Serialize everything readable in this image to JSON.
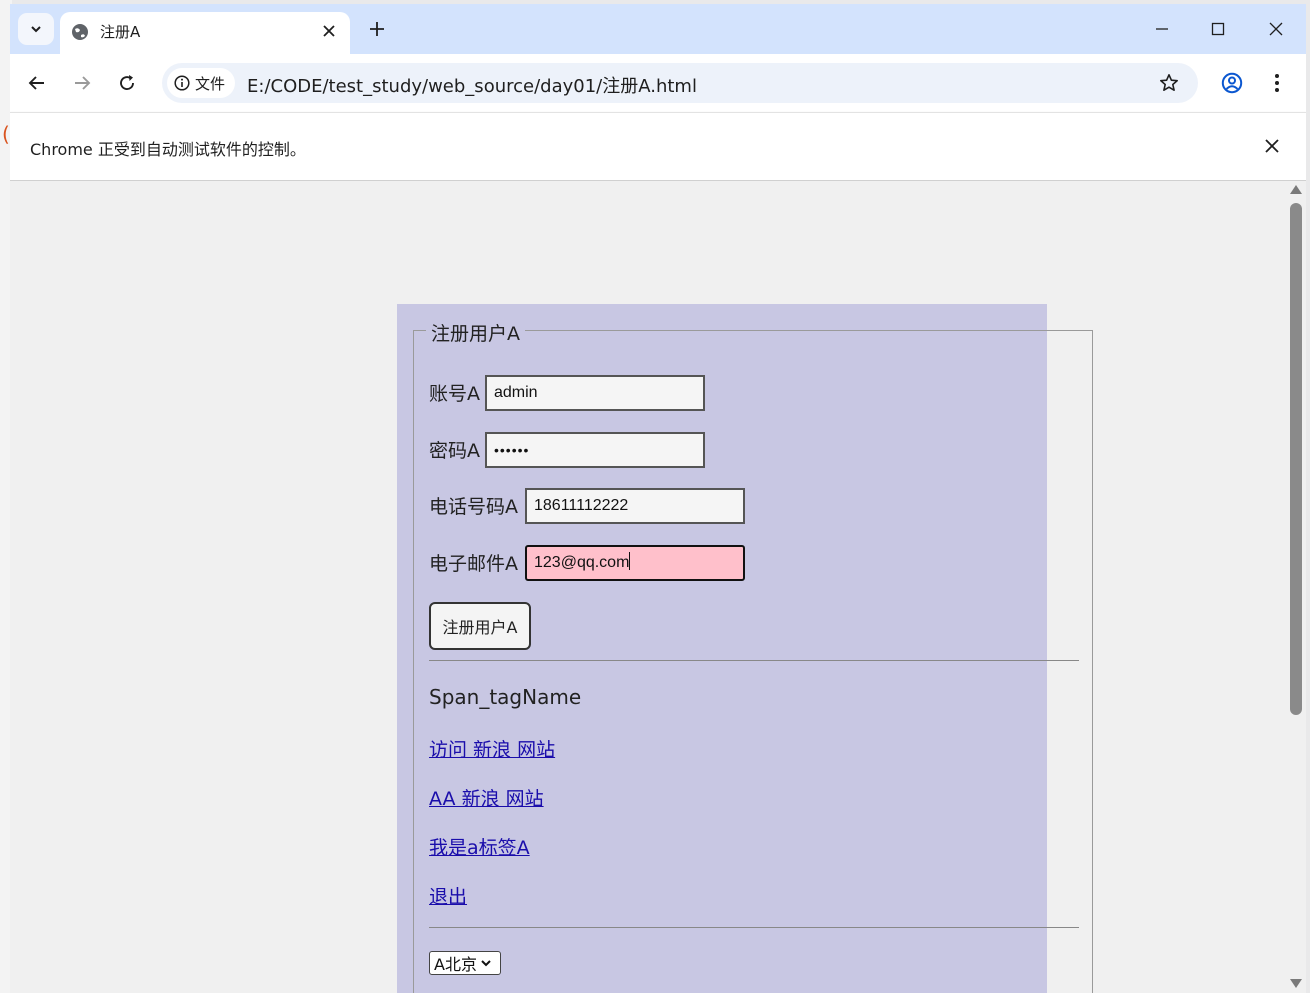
{
  "browser": {
    "tab_title": "注册A",
    "address_chip": "文件",
    "url": "E:/CODE/test_study/web_source/day01/注册A.html",
    "infobar_message": "Chrome 正受到自动测试软件的控制。"
  },
  "form": {
    "legend": "注册用户A",
    "account_label": "账号A",
    "account_value": "admin",
    "password_label": "密码A",
    "password_mask": "••••••",
    "phone_label": "电话号码A",
    "phone_value": "18611112222",
    "email_label": "电子邮件A",
    "email_value": "123@qq.com",
    "submit_label": "注册用户A"
  },
  "content": {
    "span_text": "Span_tagName",
    "links": [
      "访问 新浪 网站",
      "AA 新浪 网站",
      "我是a标签A",
      "退出"
    ],
    "select_value": "A北京"
  },
  "colors": {
    "titlebar": "#d3e3fd",
    "container_bg": "#c8c7e3",
    "focused_input_bg": "#ffc0cb",
    "link": "#1a0dab"
  }
}
